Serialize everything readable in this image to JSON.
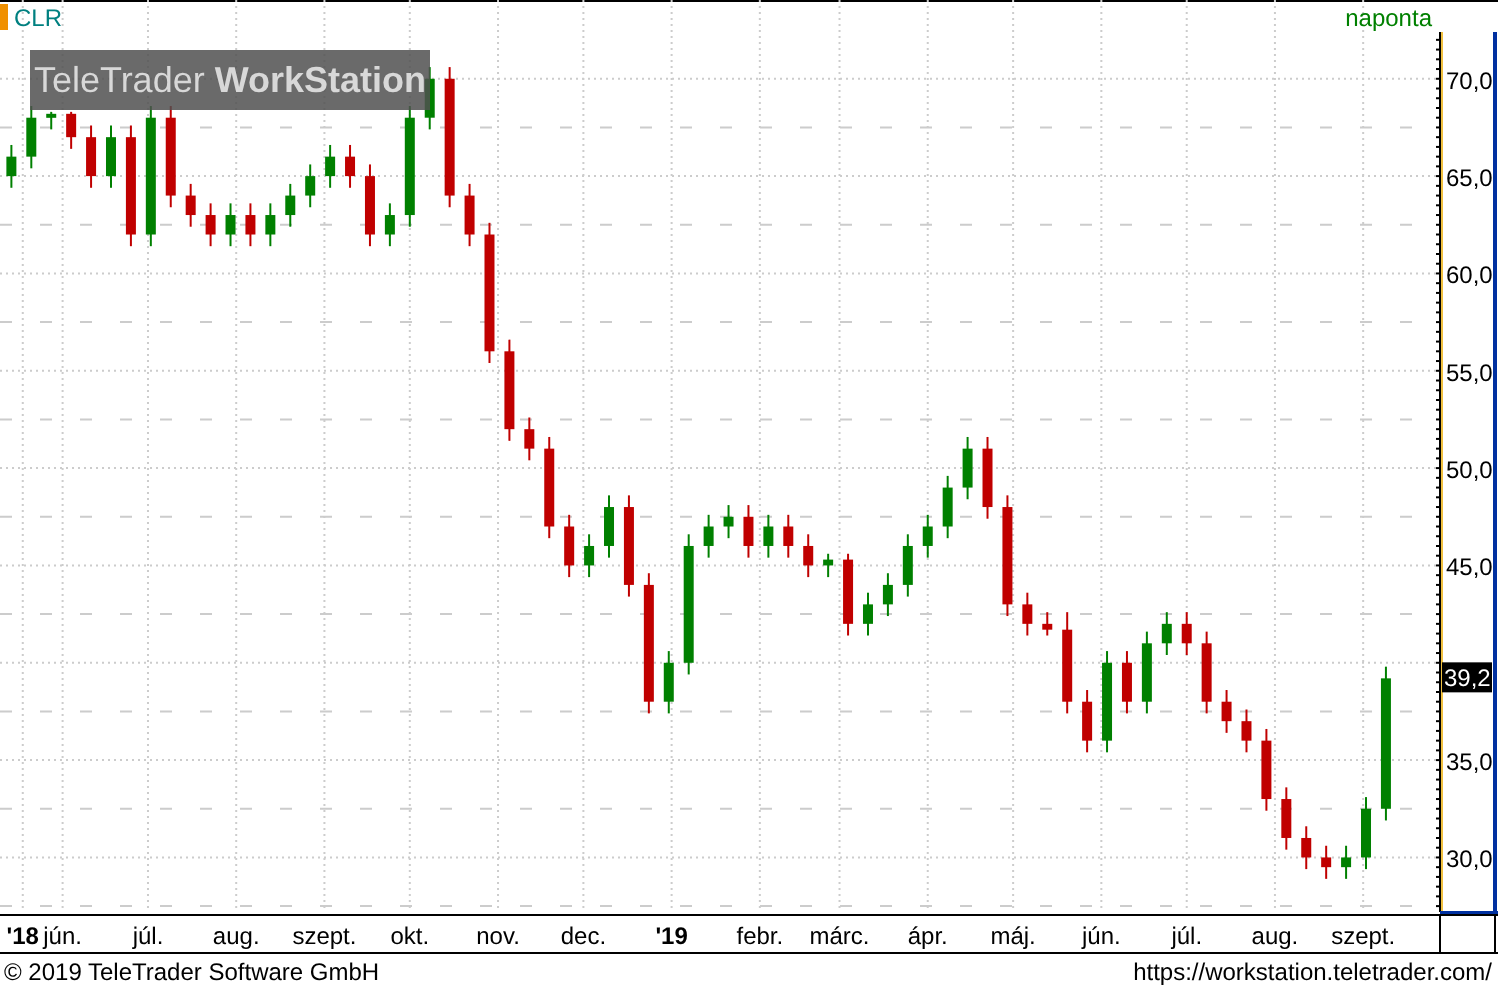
{
  "header": {
    "symbol": "CLR",
    "interval": "naponta"
  },
  "logo": "TeleTrader **WorkStation**",
  "chart_data": {
    "type": "candlestick",
    "ylim": [
      27.3,
      72.3
    ],
    "yticks": [
      {
        "value": 30,
        "label": "30,0"
      },
      {
        "value": 35,
        "label": "35,0"
      },
      {
        "value": 45,
        "label": "45,0"
      },
      {
        "value": 50,
        "label": "50,0"
      },
      {
        "value": 55,
        "label": "55,0"
      },
      {
        "value": 60,
        "label": "60,0"
      },
      {
        "value": 65,
        "label": "65,0"
      },
      {
        "value": 70,
        "label": "70,0"
      }
    ],
    "grid": true,
    "xlim": [
      "2018-05-10",
      "2019-09-28"
    ],
    "xticks": [
      {
        "value": "2018-05-18",
        "label": "'18"
      },
      {
        "value": "2018-06-01",
        "label": "jún."
      },
      {
        "value": "2018-07-01",
        "label": "júl."
      },
      {
        "value": "2018-08-01",
        "label": "aug."
      },
      {
        "value": "2018-09-01",
        "label": "szept."
      },
      {
        "value": "2018-10-01",
        "label": "okt."
      },
      {
        "value": "2018-11-01",
        "label": "nov."
      },
      {
        "value": "2018-12-01",
        "label": "dec."
      },
      {
        "value": "2019-01-01",
        "label": "'19"
      },
      {
        "value": "2019-02-01",
        "label": "febr."
      },
      {
        "value": "2019-03-01",
        "label": "márc."
      },
      {
        "value": "2019-04-01",
        "label": "ápr."
      },
      {
        "value": "2019-05-01",
        "label": "máj."
      },
      {
        "value": "2019-06-01",
        "label": "jún."
      },
      {
        "value": "2019-07-01",
        "label": "júl."
      },
      {
        "value": "2019-08-01",
        "label": "aug."
      },
      {
        "value": "2019-09-01",
        "label": "szept."
      }
    ],
    "x": [
      "2018-05-14",
      "2018-05-21",
      "2018-05-28",
      "2018-06-04",
      "2018-06-11",
      "2018-06-18",
      "2018-06-25",
      "2018-07-02",
      "2018-07-09",
      "2018-07-16",
      "2018-07-23",
      "2018-07-30",
      "2018-08-06",
      "2018-08-13",
      "2018-08-20",
      "2018-08-27",
      "2018-09-03",
      "2018-09-10",
      "2018-09-17",
      "2018-09-24",
      "2018-10-01",
      "2018-10-08",
      "2018-10-15",
      "2018-10-22",
      "2018-10-29",
      "2018-11-05",
      "2018-11-12",
      "2018-11-19",
      "2018-11-26",
      "2018-12-03",
      "2018-12-10",
      "2018-12-17",
      "2018-12-24",
      "2018-12-31",
      "2019-01-07",
      "2019-01-14",
      "2019-01-21",
      "2019-01-28",
      "2019-02-04",
      "2019-02-11",
      "2019-02-18",
      "2019-02-25",
      "2019-03-04",
      "2019-03-11",
      "2019-03-18",
      "2019-03-25",
      "2019-04-01",
      "2019-04-08",
      "2019-04-15",
      "2019-04-22",
      "2019-04-29",
      "2019-05-06",
      "2019-05-13",
      "2019-05-20",
      "2019-05-27",
      "2019-06-03",
      "2019-06-10",
      "2019-06-17",
      "2019-06-24",
      "2019-07-01",
      "2019-07-08",
      "2019-07-15",
      "2019-07-22",
      "2019-07-29",
      "2019-08-05",
      "2019-08-12",
      "2019-08-19",
      "2019-08-26",
      "2019-09-02",
      "2019-09-09"
    ],
    "ohlc": [
      [
        65,
        66.6,
        64.4,
        66
      ],
      [
        66,
        68.6,
        65.4,
        68
      ],
      [
        68,
        68.3,
        67.4,
        68.2
      ],
      [
        68.2,
        68.3,
        66.4,
        67
      ],
      [
        67,
        67.6,
        64.4,
        65
      ],
      [
        65,
        67.6,
        64.4,
        67
      ],
      [
        67,
        67.6,
        61.4,
        62
      ],
      [
        62,
        68.6,
        61.4,
        68
      ],
      [
        68,
        68.6,
        63.4,
        64
      ],
      [
        64,
        64.6,
        62.4,
        63
      ],
      [
        63,
        63.6,
        61.4,
        62
      ],
      [
        62,
        63.6,
        61.4,
        63
      ],
      [
        63,
        63.6,
        61.4,
        62
      ],
      [
        62,
        63.6,
        61.4,
        63
      ],
      [
        63,
        64.6,
        62.4,
        64
      ],
      [
        64,
        65.6,
        63.4,
        65
      ],
      [
        65,
        66.6,
        64.4,
        66
      ],
      [
        66,
        66.6,
        64.4,
        65
      ],
      [
        65,
        65.6,
        61.4,
        62
      ],
      [
        62,
        63.6,
        61.4,
        63
      ],
      [
        63,
        68.6,
        62.4,
        68
      ],
      [
        68,
        70.6,
        67.4,
        70
      ],
      [
        70,
        70.6,
        63.4,
        64
      ],
      [
        64,
        64.6,
        61.4,
        62
      ],
      [
        62,
        62.6,
        55.4,
        56
      ],
      [
        56,
        56.6,
        51.4,
        52
      ],
      [
        52,
        52.6,
        50.4,
        51
      ],
      [
        51,
        51.6,
        46.4,
        47
      ],
      [
        47,
        47.6,
        44.4,
        45
      ],
      [
        45,
        46.6,
        44.4,
        46
      ],
      [
        46,
        48.6,
        45.4,
        48
      ],
      [
        48,
        48.6,
        43.4,
        44
      ],
      [
        44,
        44.6,
        37.4,
        38
      ],
      [
        38,
        40.6,
        37.4,
        40
      ],
      [
        40,
        46.6,
        39.4,
        46
      ],
      [
        46,
        47.6,
        45.4,
        47
      ],
      [
        47,
        48.1,
        46.4,
        47.5
      ],
      [
        47.5,
        48.1,
        45.4,
        46
      ],
      [
        46,
        47.6,
        45.4,
        47
      ],
      [
        47,
        47.6,
        45.4,
        46
      ],
      [
        46,
        46.6,
        44.4,
        45
      ],
      [
        45,
        45.6,
        44.4,
        45.3
      ],
      [
        45.3,
        45.6,
        41.4,
        42
      ],
      [
        42,
        43.6,
        41.4,
        43
      ],
      [
        43,
        44.6,
        42.4,
        44
      ],
      [
        44,
        46.6,
        43.4,
        46
      ],
      [
        46,
        47.6,
        45.4,
        47
      ],
      [
        47,
        49.6,
        46.4,
        49
      ],
      [
        49,
        51.6,
        48.4,
        51
      ],
      [
        51,
        51.6,
        47.4,
        48
      ],
      [
        48,
        48.6,
        42.4,
        43
      ],
      [
        43,
        43.6,
        41.4,
        42
      ],
      [
        42,
        42.6,
        41.4,
        41.7
      ],
      [
        41.7,
        42.6,
        37.4,
        38
      ],
      [
        38,
        38.6,
        35.4,
        36
      ],
      [
        36,
        40.6,
        35.4,
        40
      ],
      [
        40,
        40.6,
        37.4,
        38
      ],
      [
        38,
        41.6,
        37.4,
        41
      ],
      [
        41,
        42.6,
        40.4,
        42
      ],
      [
        42,
        42.6,
        40.4,
        41
      ],
      [
        41,
        41.6,
        37.4,
        38
      ],
      [
        38,
        38.6,
        36.4,
        37
      ],
      [
        37,
        37.6,
        35.4,
        36
      ],
      [
        36,
        36.6,
        32.4,
        33
      ],
      [
        33,
        33.6,
        30.4,
        31
      ],
      [
        31,
        31.6,
        29.4,
        30
      ],
      [
        30,
        30.6,
        28.9,
        29.5
      ],
      [
        29.5,
        30.6,
        28.9,
        30
      ],
      [
        30,
        33.1,
        29.4,
        32.5
      ],
      [
        32.5,
        39.8,
        31.9,
        39.2
      ]
    ]
  },
  "last_price": "39,2",
  "footer": {
    "copyright": "© 2019 TeleTrader Software GmbH",
    "url": "https://workstation.teletrader.com/"
  }
}
